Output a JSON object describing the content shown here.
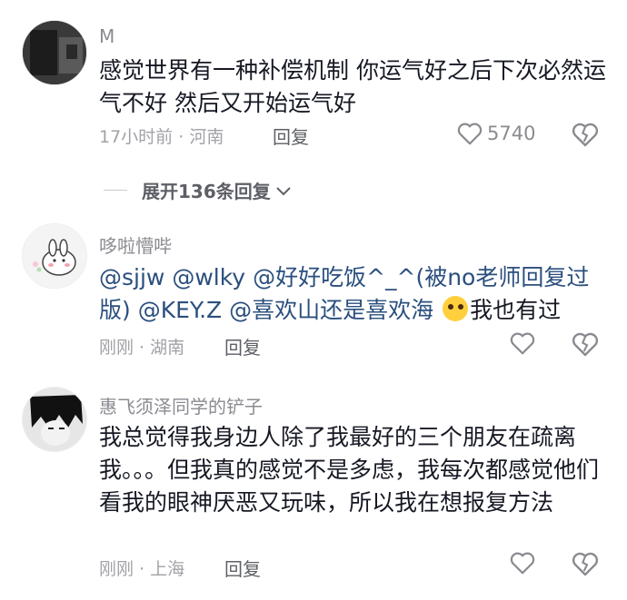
{
  "comments": [
    {
      "username": "M",
      "text": "感觉世界有一种补偿机制  你运气好之后下次必然运气不好  然后又开始运气好",
      "time": "17小时前",
      "location": "河南",
      "reply_label": "回复",
      "likes": "5740"
    },
    {
      "username": "哆啦懵哔",
      "segments": [
        {
          "type": "mention",
          "text": "@sjjw"
        },
        {
          "type": "text",
          "text": " "
        },
        {
          "type": "mention",
          "text": "@wlky"
        },
        {
          "type": "text",
          "text": " "
        },
        {
          "type": "mention",
          "text": "@好好吃饭^_^(被no老师回复过版)"
        },
        {
          "type": "text",
          "text": " "
        },
        {
          "type": "mention",
          "text": "@KEY.Z"
        },
        {
          "type": "text",
          "text": " "
        },
        {
          "type": "mention",
          "text": "@喜欢山还是喜欢海"
        },
        {
          "type": "text",
          "text": " "
        },
        {
          "type": "emoji",
          "name": "crying-laughing-emoji"
        },
        {
          "type": "text",
          "text": "我也有过"
        }
      ],
      "time": "刚刚",
      "location": "湖南",
      "reply_label": "回复"
    },
    {
      "username": "惠飞须泽同学的铲子",
      "text": "我总觉得我身边人除了我最好的三个朋友在疏离我。。。但我真的感觉不是多虑，我每次都感觉他们看我的眼神厌恶又玩味，所以我在想报复方法",
      "time": "刚刚",
      "location": "上海",
      "reply_label": "回复"
    }
  ],
  "expand_replies": {
    "label": "展开136条回复"
  },
  "meta_separator": " · ",
  "icons": {
    "like": "heart-outline-icon",
    "dislike": "broken-heart-icon",
    "expand": "chevron-down-icon"
  }
}
